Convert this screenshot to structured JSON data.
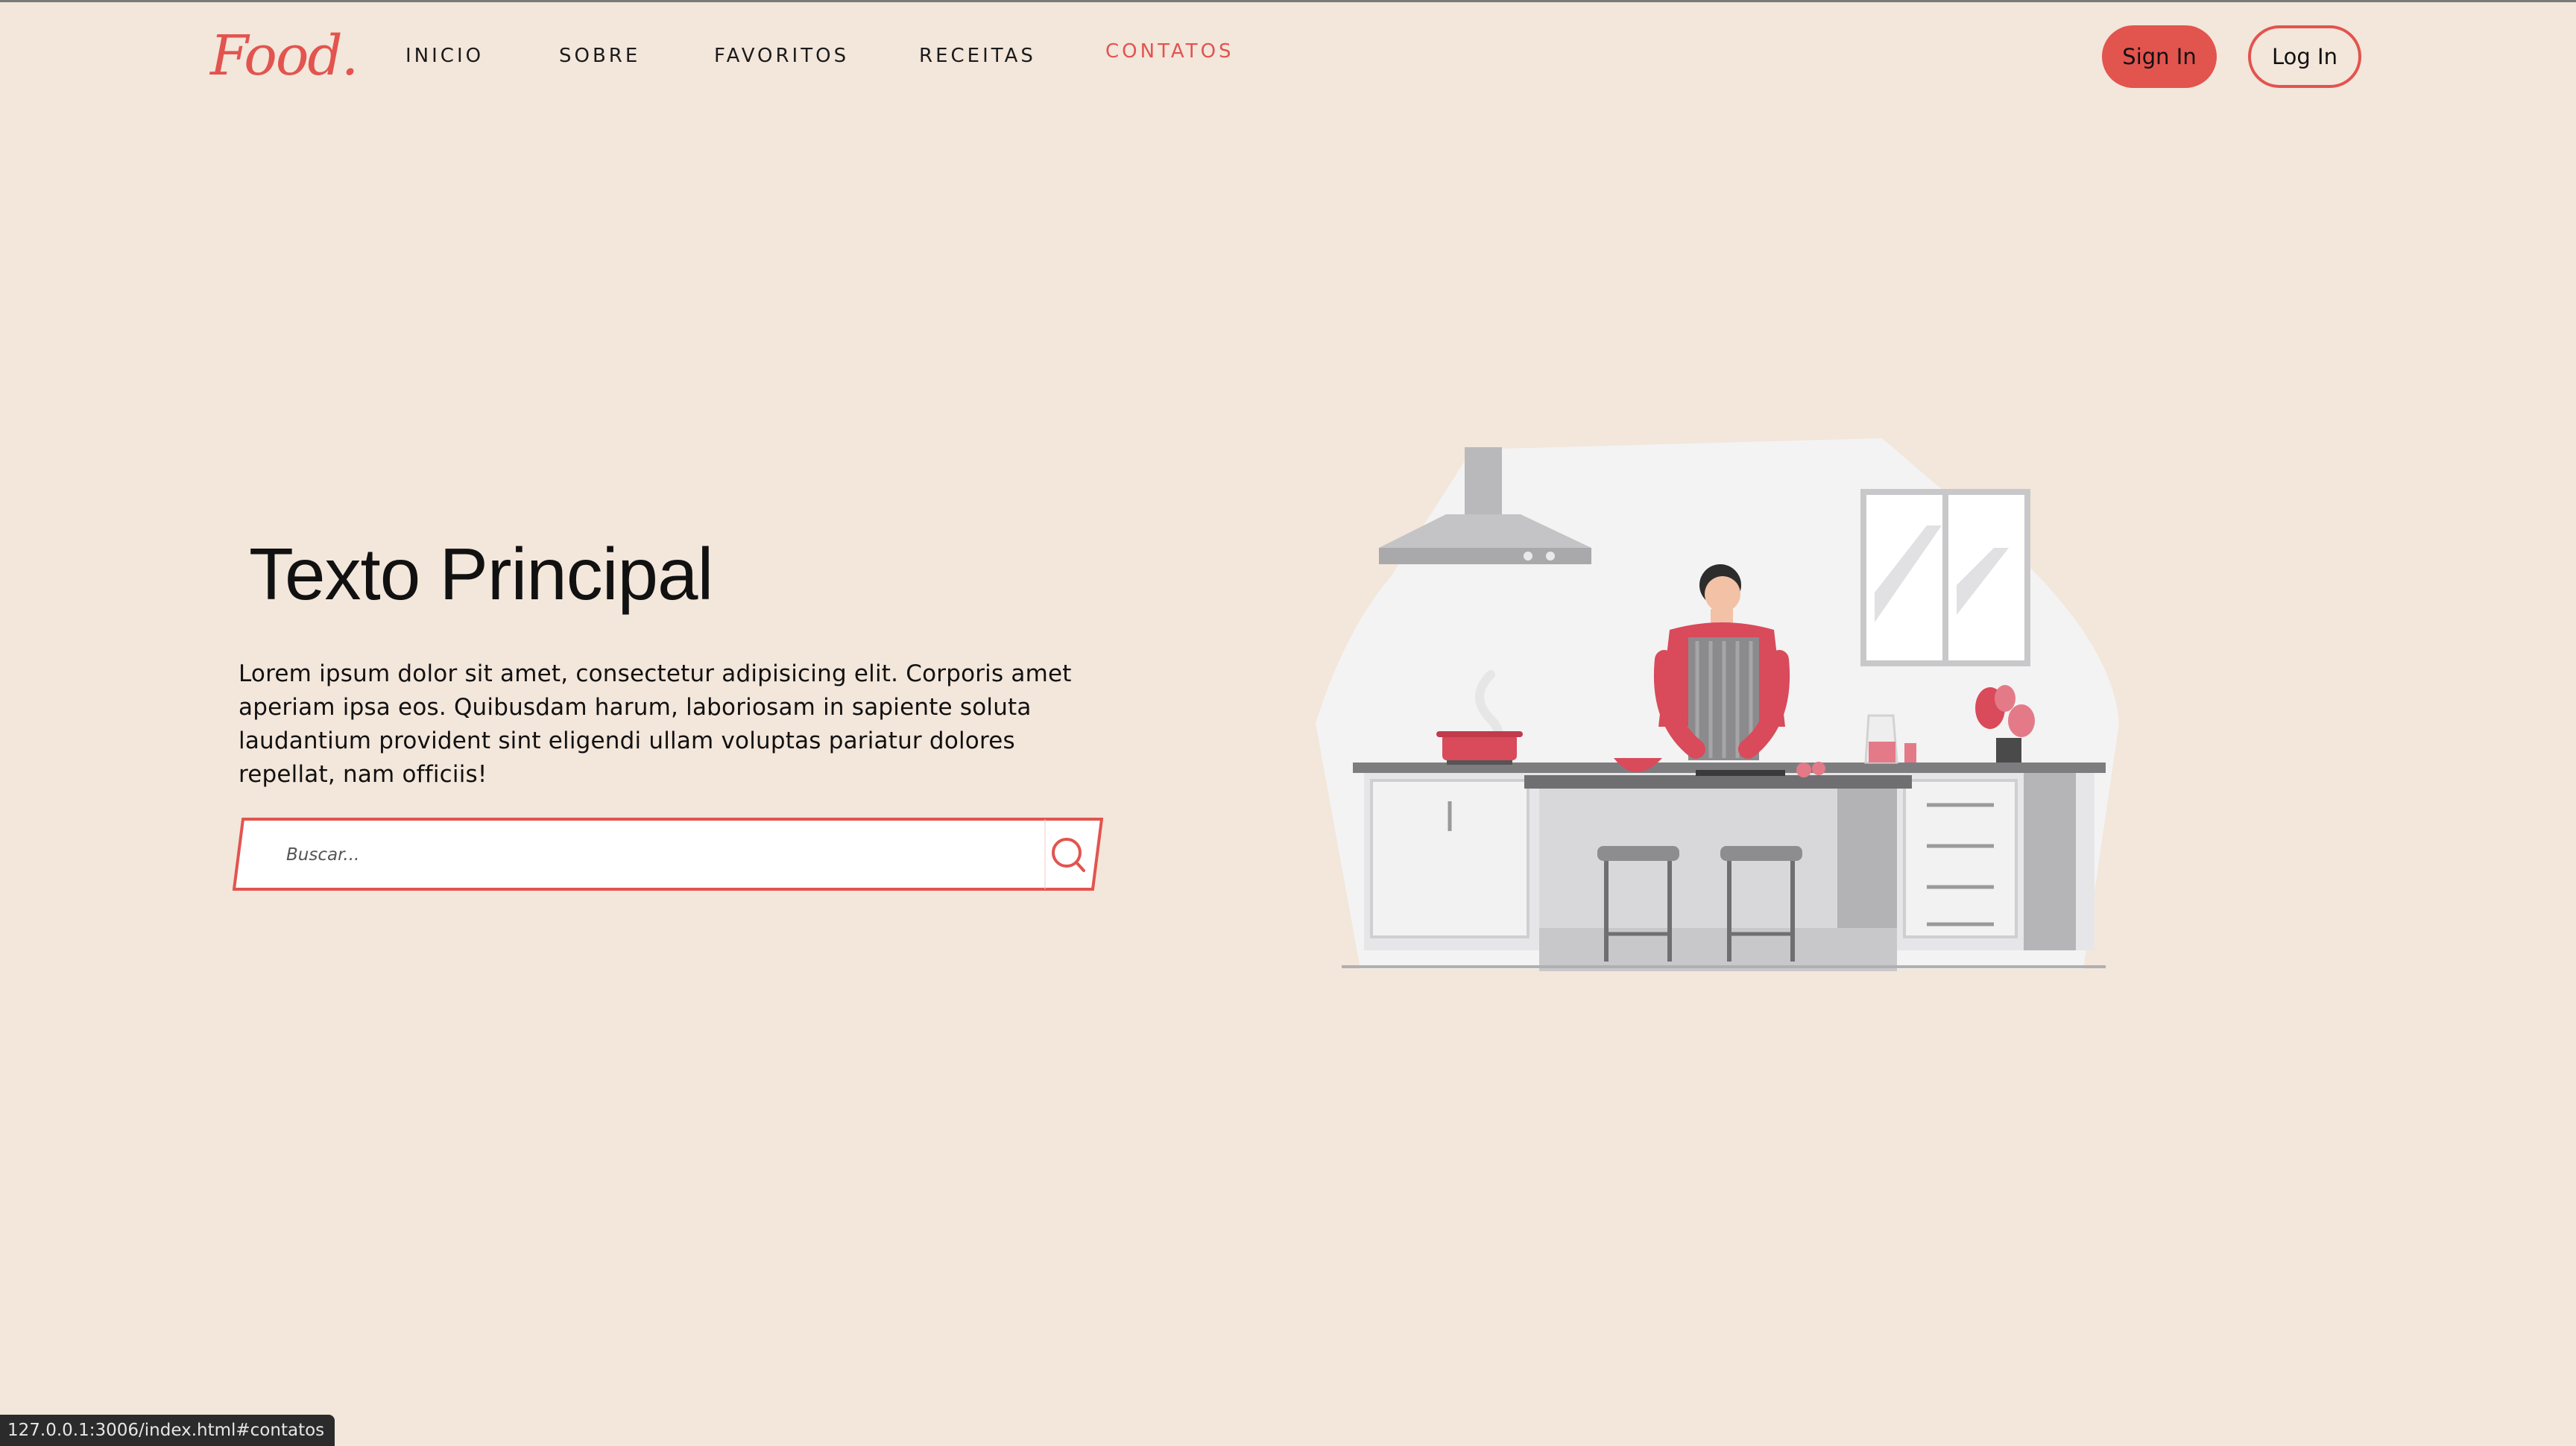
{
  "brand": {
    "logo_text": "Food.",
    "accent_color": "#e2544e",
    "background_color": "#f3e6db"
  },
  "nav": {
    "items": [
      {
        "label": "INICIO"
      },
      {
        "label": "SOBRE"
      },
      {
        "label": "FAVORITOS"
      },
      {
        "label": "RECEITAS"
      },
      {
        "label": "CONTATOS",
        "active": true
      }
    ],
    "signin_label": "Sign In",
    "login_label": "Log In"
  },
  "hero": {
    "title": "Texto Principal",
    "text": "Lorem ipsum dolor sit amet, consectetur adipisicing elit. Corporis amet aperiam ipsa eos. Quibusdam harum, laboriosam in sapiente soluta laudantium provident sint eligendi ullam voluptas pariatur dolores repellat, nam officiis!",
    "search": {
      "placeholder": "Buscar...",
      "value": "",
      "icon": "search-icon"
    },
    "illustration": "chef-cooking-in-kitchen-illustration"
  },
  "status_bar": {
    "url": "127.0.0.1:3006/index.html#contatos"
  }
}
